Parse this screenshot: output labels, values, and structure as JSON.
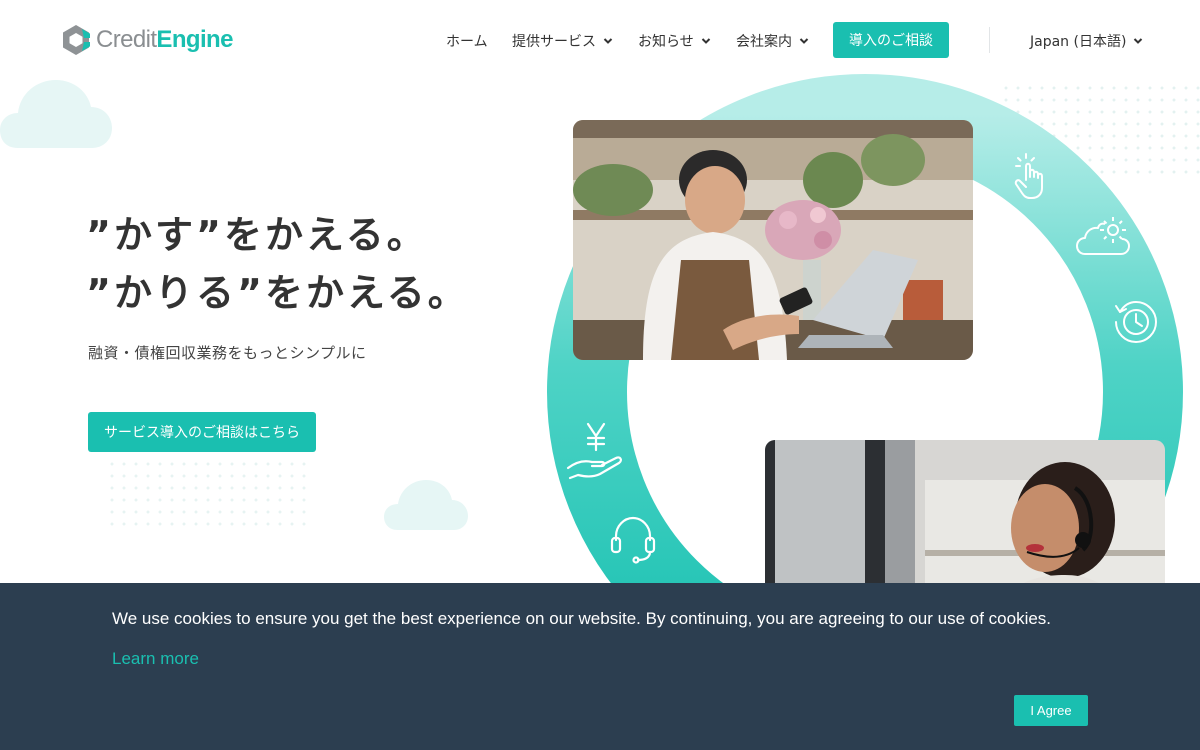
{
  "brand": {
    "logo_text_light": "Credit",
    "logo_text_bold": "Engine",
    "accent_color": "#1abfb0",
    "text_color": "#333333"
  },
  "nav": {
    "home": "ホーム",
    "services": "提供サービス",
    "news": "お知らせ",
    "company": "会社案内",
    "cta": "導入のご相談",
    "language": "Japan (日本語)"
  },
  "hero": {
    "headline_line1": "”かす”をかえる。",
    "headline_line2": "”かりる”をかえる。",
    "subtitle": "融資・債権回収業務をもっとシンプルに",
    "cta": "サービス導入のご相談はこちら"
  },
  "ring_icons": [
    "tap-icon",
    "cloud-gear-icon",
    "history-icon",
    "yen-hand-icon",
    "headset-icon"
  ],
  "photos": [
    "florist-with-phone-photo",
    "call-center-agent-photo"
  ],
  "cookie": {
    "text": "We use cookies to ensure you get the best experience on our website. By continuing, you are agreeing to our use of cookies.",
    "learn_more": "Learn more",
    "agree": "I Agree",
    "background": "#2c3e50"
  }
}
